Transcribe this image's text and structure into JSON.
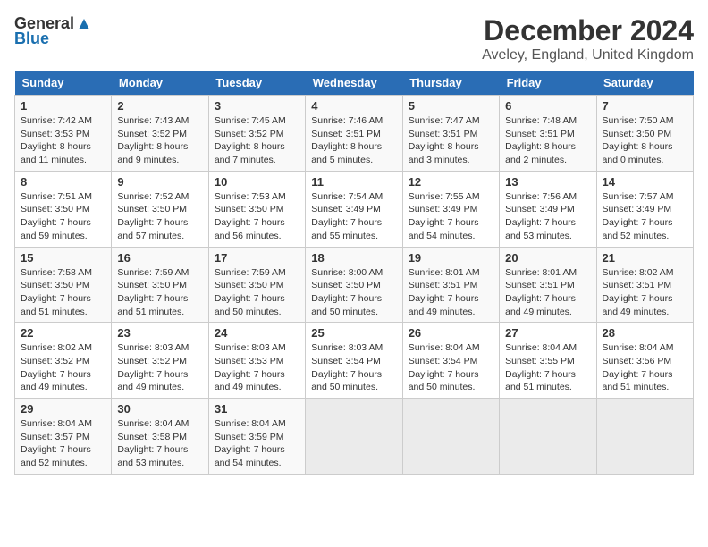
{
  "logo": {
    "general": "General",
    "blue": "Blue"
  },
  "title": "December 2024",
  "location": "Aveley, England, United Kingdom",
  "days_of_week": [
    "Sunday",
    "Monday",
    "Tuesday",
    "Wednesday",
    "Thursday",
    "Friday",
    "Saturday"
  ],
  "weeks": [
    [
      {
        "day": 1,
        "info": "Sunrise: 7:42 AM\nSunset: 3:53 PM\nDaylight: 8 hours\nand 11 minutes."
      },
      {
        "day": 2,
        "info": "Sunrise: 7:43 AM\nSunset: 3:52 PM\nDaylight: 8 hours\nand 9 minutes."
      },
      {
        "day": 3,
        "info": "Sunrise: 7:45 AM\nSunset: 3:52 PM\nDaylight: 8 hours\nand 7 minutes."
      },
      {
        "day": 4,
        "info": "Sunrise: 7:46 AM\nSunset: 3:51 PM\nDaylight: 8 hours\nand 5 minutes."
      },
      {
        "day": 5,
        "info": "Sunrise: 7:47 AM\nSunset: 3:51 PM\nDaylight: 8 hours\nand 3 minutes."
      },
      {
        "day": 6,
        "info": "Sunrise: 7:48 AM\nSunset: 3:51 PM\nDaylight: 8 hours\nand 2 minutes."
      },
      {
        "day": 7,
        "info": "Sunrise: 7:50 AM\nSunset: 3:50 PM\nDaylight: 8 hours\nand 0 minutes."
      }
    ],
    [
      {
        "day": 8,
        "info": "Sunrise: 7:51 AM\nSunset: 3:50 PM\nDaylight: 7 hours\nand 59 minutes."
      },
      {
        "day": 9,
        "info": "Sunrise: 7:52 AM\nSunset: 3:50 PM\nDaylight: 7 hours\nand 57 minutes."
      },
      {
        "day": 10,
        "info": "Sunrise: 7:53 AM\nSunset: 3:50 PM\nDaylight: 7 hours\nand 56 minutes."
      },
      {
        "day": 11,
        "info": "Sunrise: 7:54 AM\nSunset: 3:49 PM\nDaylight: 7 hours\nand 55 minutes."
      },
      {
        "day": 12,
        "info": "Sunrise: 7:55 AM\nSunset: 3:49 PM\nDaylight: 7 hours\nand 54 minutes."
      },
      {
        "day": 13,
        "info": "Sunrise: 7:56 AM\nSunset: 3:49 PM\nDaylight: 7 hours\nand 53 minutes."
      },
      {
        "day": 14,
        "info": "Sunrise: 7:57 AM\nSunset: 3:49 PM\nDaylight: 7 hours\nand 52 minutes."
      }
    ],
    [
      {
        "day": 15,
        "info": "Sunrise: 7:58 AM\nSunset: 3:50 PM\nDaylight: 7 hours\nand 51 minutes."
      },
      {
        "day": 16,
        "info": "Sunrise: 7:59 AM\nSunset: 3:50 PM\nDaylight: 7 hours\nand 51 minutes."
      },
      {
        "day": 17,
        "info": "Sunrise: 7:59 AM\nSunset: 3:50 PM\nDaylight: 7 hours\nand 50 minutes."
      },
      {
        "day": 18,
        "info": "Sunrise: 8:00 AM\nSunset: 3:50 PM\nDaylight: 7 hours\nand 50 minutes."
      },
      {
        "day": 19,
        "info": "Sunrise: 8:01 AM\nSunset: 3:51 PM\nDaylight: 7 hours\nand 49 minutes."
      },
      {
        "day": 20,
        "info": "Sunrise: 8:01 AM\nSunset: 3:51 PM\nDaylight: 7 hours\nand 49 minutes."
      },
      {
        "day": 21,
        "info": "Sunrise: 8:02 AM\nSunset: 3:51 PM\nDaylight: 7 hours\nand 49 minutes."
      }
    ],
    [
      {
        "day": 22,
        "info": "Sunrise: 8:02 AM\nSunset: 3:52 PM\nDaylight: 7 hours\nand 49 minutes."
      },
      {
        "day": 23,
        "info": "Sunrise: 8:03 AM\nSunset: 3:52 PM\nDaylight: 7 hours\nand 49 minutes."
      },
      {
        "day": 24,
        "info": "Sunrise: 8:03 AM\nSunset: 3:53 PM\nDaylight: 7 hours\nand 49 minutes."
      },
      {
        "day": 25,
        "info": "Sunrise: 8:03 AM\nSunset: 3:54 PM\nDaylight: 7 hours\nand 50 minutes."
      },
      {
        "day": 26,
        "info": "Sunrise: 8:04 AM\nSunset: 3:54 PM\nDaylight: 7 hours\nand 50 minutes."
      },
      {
        "day": 27,
        "info": "Sunrise: 8:04 AM\nSunset: 3:55 PM\nDaylight: 7 hours\nand 51 minutes."
      },
      {
        "day": 28,
        "info": "Sunrise: 8:04 AM\nSunset: 3:56 PM\nDaylight: 7 hours\nand 51 minutes."
      }
    ],
    [
      {
        "day": 29,
        "info": "Sunrise: 8:04 AM\nSunset: 3:57 PM\nDaylight: 7 hours\nand 52 minutes."
      },
      {
        "day": 30,
        "info": "Sunrise: 8:04 AM\nSunset: 3:58 PM\nDaylight: 7 hours\nand 53 minutes."
      },
      {
        "day": 31,
        "info": "Sunrise: 8:04 AM\nSunset: 3:59 PM\nDaylight: 7 hours\nand 54 minutes."
      },
      null,
      null,
      null,
      null
    ]
  ]
}
